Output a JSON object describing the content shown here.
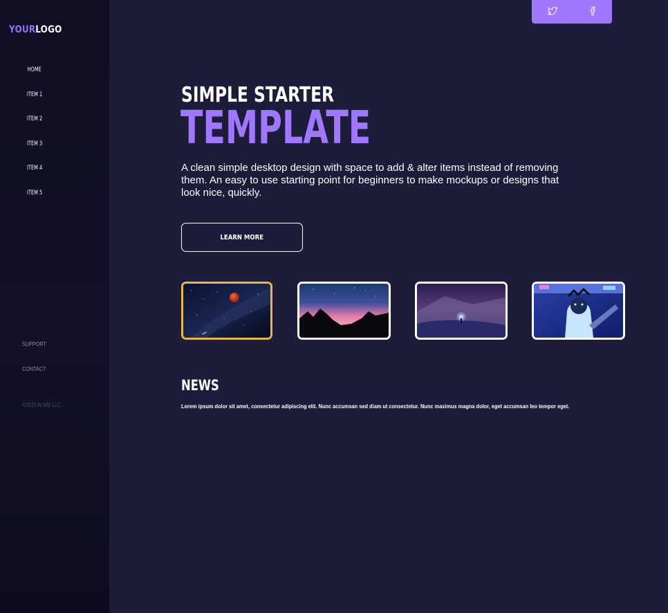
{
  "brand": {
    "logo_part1": "YOUR",
    "logo_part2": "LOGO",
    "accent_color": "#a077ff",
    "selected_color": "#e8b844"
  },
  "sidebar": {
    "nav": [
      {
        "label": "HOME"
      },
      {
        "label": "ITEM 1"
      },
      {
        "label": "ITEM 2"
      },
      {
        "label": "ITEM 3"
      },
      {
        "label": "ITEM 4"
      },
      {
        "label": "ITEM 5"
      }
    ],
    "footer_links": [
      {
        "label": "SUPPORT"
      },
      {
        "label": "CONTACT"
      }
    ],
    "copyright": "©2020 ACME LLC."
  },
  "social": [
    {
      "icon": "twitter-icon"
    },
    {
      "icon": "facebook-icon"
    }
  ],
  "hero": {
    "subtitle": "SIMPLE STARTER",
    "title": "TEMPLATE",
    "description": "A clean simple desktop design with space to add & alter items instead of removing them. An easy to use starting point for beginners to make mockups or designs that look nice, quickly.",
    "button_label": "LEARN MORE"
  },
  "gallery": [
    {
      "subject": "blood moon over milky way",
      "selected": true
    },
    {
      "subject": "pink aurora over rocky hills",
      "selected": false
    },
    {
      "subject": "figure under purple starry sky",
      "selected": false
    },
    {
      "subject": "neon portrait",
      "selected": false
    }
  ],
  "news": {
    "title": "NEWS",
    "body": "Lorem ipsum dolor sit amet, consectetur adipiscing elit. Nunc accumsan sed diam ut consectetur. Nunc maximus magna dolor, eget accumsan leo tempor eget."
  }
}
